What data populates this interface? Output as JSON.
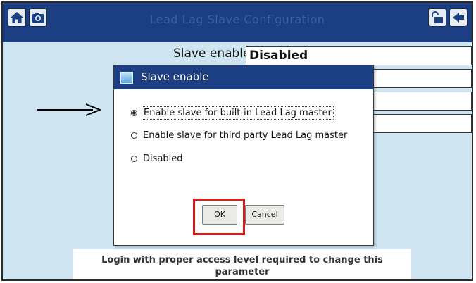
{
  "window": {
    "title": "Lead Lag Slave Configuration",
    "icons": [
      "home-icon",
      "camera-icon",
      "unlock-icon",
      "back-arrow-icon"
    ]
  },
  "main": {
    "slave_enable_label": "Slave enable",
    "slave_enable_value": "Disabled"
  },
  "dialog": {
    "title": "Slave enable",
    "options": [
      {
        "label": "Enable slave for built-in Lead Lag master",
        "selected": true
      },
      {
        "label": "Enable slave for third party Lead Lag master",
        "selected": false
      },
      {
        "label": "Disabled",
        "selected": false
      }
    ],
    "ok_label": "OK",
    "cancel_label": "Cancel"
  },
  "footer": {
    "message": "Login with proper access level required to change this parameter"
  },
  "colors": {
    "title_bar": "#1b3f82",
    "screen_bg": "#cfe5f2",
    "highlight": "#e01818"
  }
}
